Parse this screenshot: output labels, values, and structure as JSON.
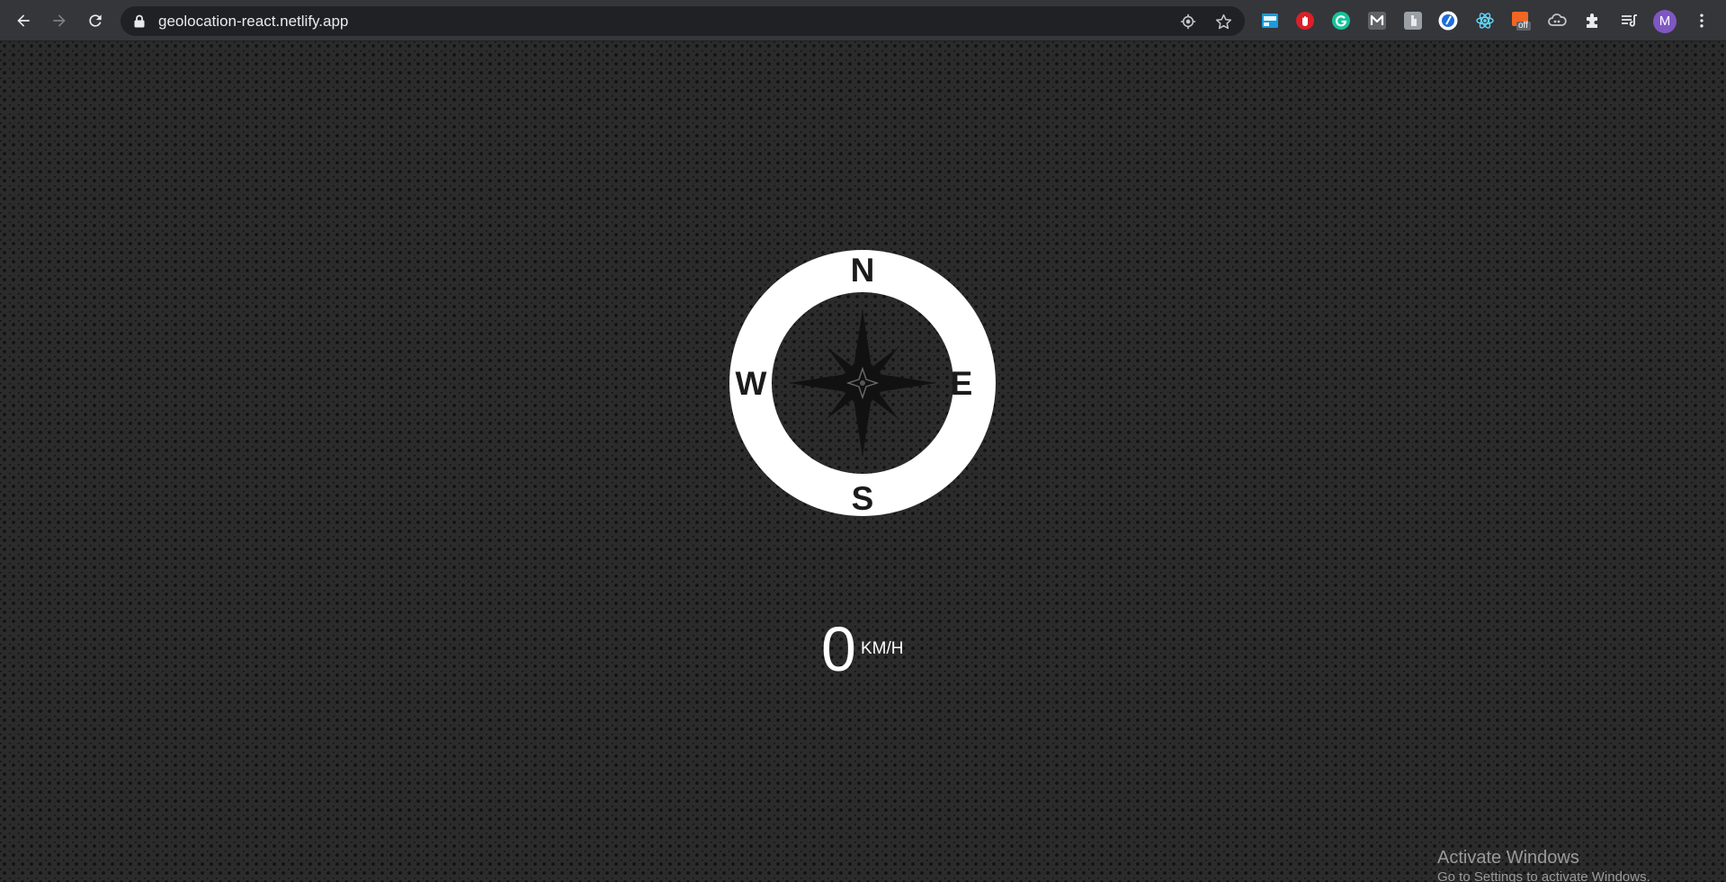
{
  "browser": {
    "url": "geolocation-react.netlify.app",
    "avatar_letter": "M",
    "extensions": [
      "ext-blue-window-icon",
      "ext-red-hand-icon",
      "grammarly-icon",
      "ext-m-icon",
      "ext-grey-page-icon",
      "ext-white-circle-icon",
      "react-devtools-icon",
      "ext-off-badge-icon",
      "cloud-icon",
      "puzzle-icon",
      "reading-list-icon"
    ],
    "extension_badge": "off"
  },
  "compass": {
    "north": "N",
    "east": "E",
    "south": "S",
    "west": "W"
  },
  "speed": {
    "value": "0",
    "unit": "KM/H"
  },
  "windows_watermark": {
    "title": "Activate Windows",
    "subtitle": "Go to Settings to activate Windows."
  },
  "colors": {
    "background": "#2b2b2c",
    "compass_ring": "#ffffff",
    "compass_rose": "#111111",
    "toolbar": "#35363a",
    "avatar": "#7e57c2"
  }
}
